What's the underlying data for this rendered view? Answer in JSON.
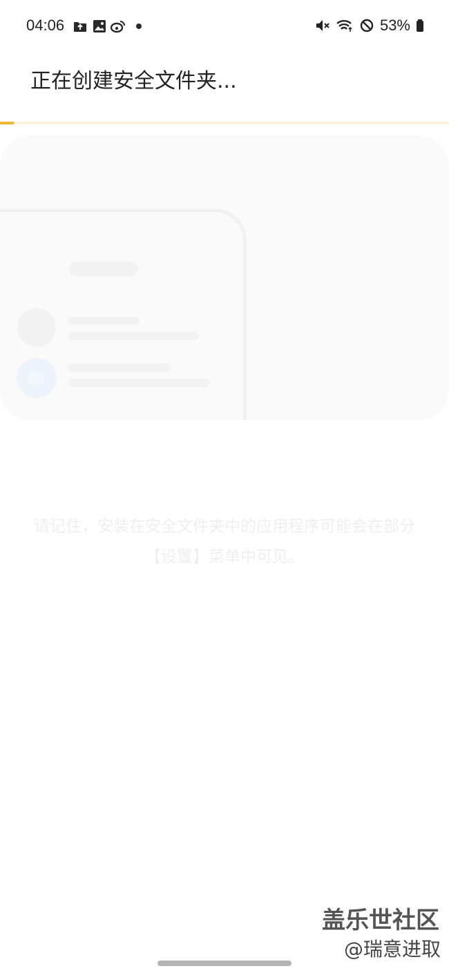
{
  "status_bar": {
    "time": "04:06",
    "notification_icons": [
      "folder-upload-icon",
      "image-icon",
      "weibo-icon",
      "dot-icon"
    ],
    "system_icons": [
      "mute-icon",
      "wifi-icon",
      "do-not-disturb-icon",
      "battery-icon"
    ],
    "battery_text": "53%"
  },
  "header": {
    "title": "正在创建安全文件夹..."
  },
  "progress": {
    "fraction": 0.03,
    "track_color": "#fbf3dc",
    "fill_color": "#f2b531"
  },
  "note": {
    "text": "请记住，安装在安全文件夹中的应用程序可能会在部分【设置】菜单中可见。"
  },
  "watermark": {
    "title": "盖乐世社区",
    "author": "@瑞意进取"
  }
}
